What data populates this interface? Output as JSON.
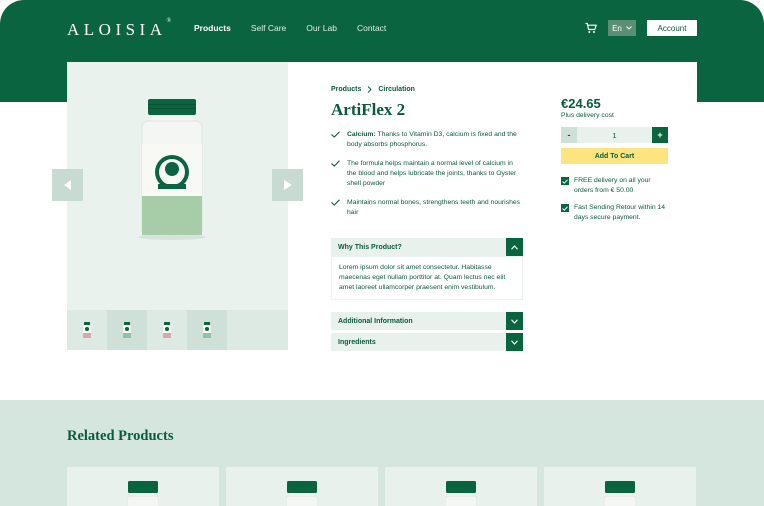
{
  "header": {
    "logo": "ALOISIA",
    "logo_mark": "®",
    "nav": [
      {
        "label": "Products",
        "active": true
      },
      {
        "label": "Self Care",
        "active": false
      },
      {
        "label": "Our Lab",
        "active": false
      },
      {
        "label": "Contact",
        "active": false
      }
    ],
    "cart_icon": "cart-icon",
    "language": "En",
    "account": "Account"
  },
  "gallery": {
    "prev_icon": "chevron-left-icon",
    "next_icon": "chevron-right-icon",
    "thumb_colors": [
      "#d9a9a9",
      "#8fc3a0",
      "#d9a9a9",
      "#8fc3a0"
    ]
  },
  "product": {
    "breadcrumb": [
      "Products",
      "Circulation"
    ],
    "title": "ArtiFlex 2",
    "features": [
      {
        "bold": "Calcium:",
        "text": " Thanks to Vitamin D3, calcium is fixed and the body absorbs phosphorus."
      },
      {
        "bold": "",
        "text": "The formula helps maintain a normal level of calcium in the blood and helps lubricate the joints, thanks to Oyster shell powder"
      },
      {
        "bold": "",
        "text": "Maintains normal bones, strengthens teeth and nourishes hair"
      }
    ],
    "accordions": [
      {
        "title": "Why This Product?",
        "open": true,
        "body": "Lorem ipsum dolor sit amet consectetur. Habitasse maecenas eget nullam porttitor at. Quam lectus nec elit amet laoreet ullamcorper praesent enim vestibulum."
      },
      {
        "title": "Additional Information",
        "open": false
      },
      {
        "title": "Ingredients",
        "open": false
      }
    ]
  },
  "purchase": {
    "price": "€24.65",
    "shipping": "Plus delivery cost",
    "minus": "-",
    "quantity": "1",
    "plus": "+",
    "add_to_cart": "Add To Cart",
    "perks": [
      "FREE delivery on all your orders from € 50.00",
      "Fast Sending Retour within 14 days secure payment."
    ]
  },
  "related": {
    "title": "Related Products"
  },
  "colors": {
    "brand_green": "#0b6440",
    "light_green": "#e8f1ec",
    "cart_yellow": "#fde47f",
    "related_bg": "#d5e6de"
  }
}
